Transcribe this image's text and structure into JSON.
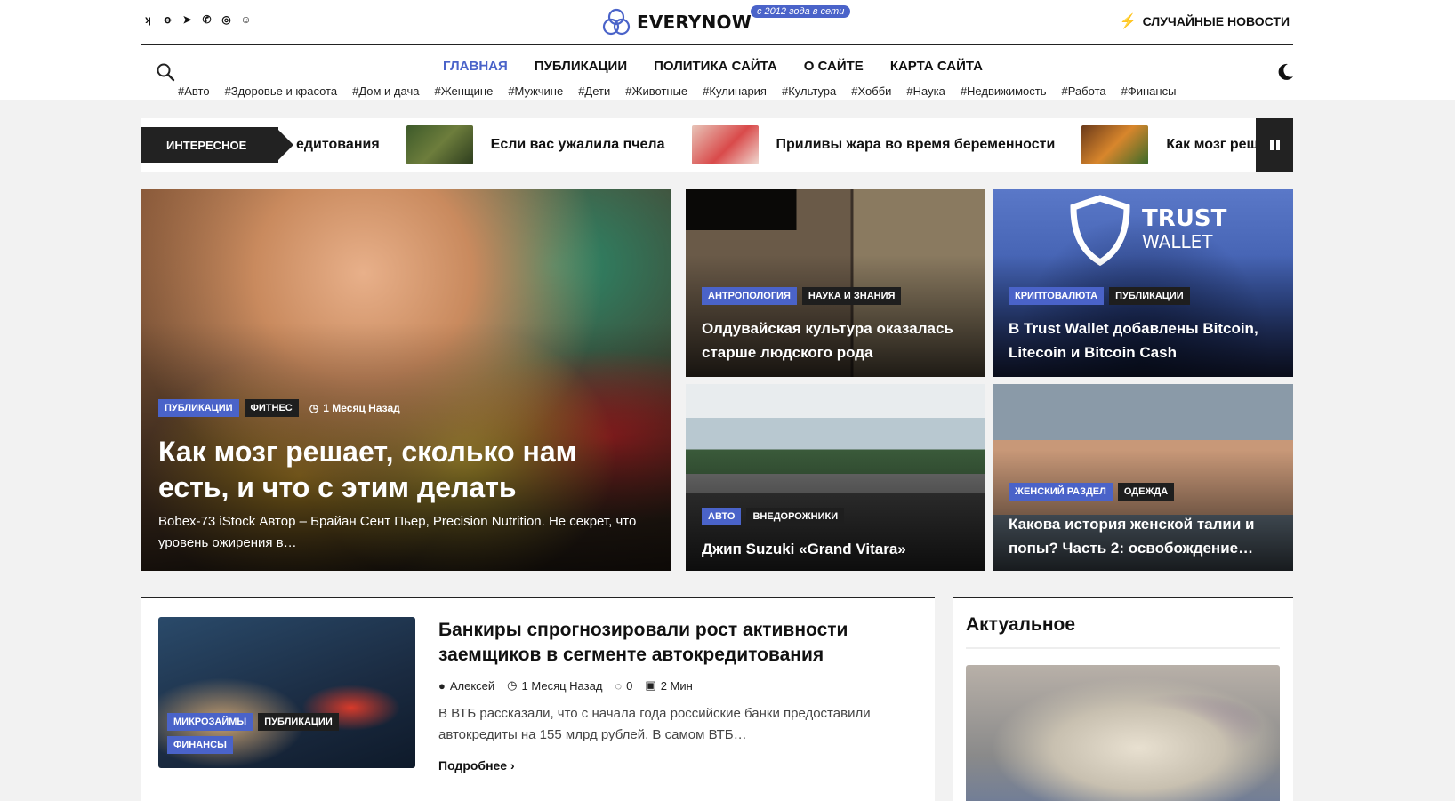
{
  "header": {
    "logo_text": "EVERYNOW",
    "logo_badge": "с 2012 года в сети",
    "random_news": "СЛУЧАЙНЫЕ НОВОСТИ",
    "social": [
      {
        "name": "vk-icon",
        "glyph": "ʞ"
      },
      {
        "name": "odnoklassniki-icon",
        "glyph": "ꝋ"
      },
      {
        "name": "telegram-icon",
        "glyph": "➤"
      },
      {
        "name": "viber-icon",
        "glyph": "✆"
      },
      {
        "name": "whatsapp-icon",
        "glyph": "◎"
      },
      {
        "name": "mail-icon",
        "glyph": "☺"
      }
    ]
  },
  "nav": {
    "items": [
      "ГЛАВНАЯ",
      "ПУБЛИКАЦИИ",
      "ПОЛИТИКА САЙТА",
      "О САЙТЕ",
      "КАРТА САЙТА"
    ],
    "active_index": 0
  },
  "tags": [
    "#Авто",
    "#Здоровье и красота",
    "#Дом и дача",
    "#Женщине",
    "#Мужчине",
    "#Дети",
    "#Животные",
    "#Кулинария",
    "#Культура",
    "#Хобби",
    "#Наука",
    "#Недвижимость",
    "#Работа",
    "#Финансы"
  ],
  "ticker": {
    "label": "ИНТЕРЕСНОЕ",
    "items": [
      "едитования",
      "Если вас ужалила пчела",
      "Приливы жара во время беременности",
      "Как мозг реш"
    ]
  },
  "featured": {
    "main": {
      "badges": [
        "ПУБЛИКАЦИИ",
        "ФИТНЕС"
      ],
      "time": "1 Месяц Назад",
      "title": "Как мозг решает, сколько нам есть, и что с этим делать",
      "excerpt": "Bobex-73 iStock Автор – Брайан Сент Пьер, Precision Nutrition. Не секрет, что уровень ожирения в…"
    },
    "cards": [
      {
        "badges": [
          "АНТРОПОЛОГИЯ",
          "НАУКА И ЗНАНИЯ"
        ],
        "title": "Олдувайская культура оказалась старше людского рода"
      },
      {
        "badges": [
          "КРИПТОВАЛЮТА",
          "ПУБЛИКАЦИИ"
        ],
        "title": "В Trust Wallet добавлены Bitcoin, Litecoin и Bitcoin Cash",
        "image_text": [
          "TRUST",
          "WALLET"
        ]
      },
      {
        "badges": [
          "АВТО",
          "ВНЕДОРОЖНИКИ"
        ],
        "title": "Джип Suzuki «Grand Vitara»"
      },
      {
        "badges": [
          "ЖЕНСКИЙ РАЗДЕЛ",
          "ОДЕЖДА"
        ],
        "title": "Какова история женской талии и попы? Часть 2: освобождение…"
      }
    ]
  },
  "post": {
    "badges": [
      "МИКРОЗАЙМЫ",
      "ПУБЛИКАЦИИ",
      "ФИНАНСЫ"
    ],
    "title": "Банкиры спрогнозировали рост активности заемщиков в сегменте автокредитования",
    "author": "Алексей",
    "time": "1 Месяц Назад",
    "comments": "0",
    "read_time": "2 Мин",
    "excerpt": "В ВТБ рассказали, что с начала года российские банки предоставили автокредиты на 155 млрд рублей. В самом ВТБ…",
    "read_more": "Подробнее"
  },
  "sidebar": {
    "title": "Актуальное"
  },
  "colors": {
    "accent": "#4a63c9",
    "dark": "#1e1e1e"
  }
}
